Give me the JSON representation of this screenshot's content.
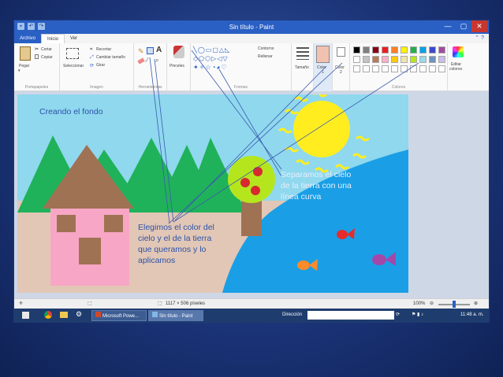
{
  "window": {
    "title": "Sin título - Paint",
    "menu": {
      "file": "Archivo",
      "home": "Inicio",
      "view": "Ver"
    }
  },
  "ribbon": {
    "clipboard": {
      "paste": "Pegar",
      "cut": "Cortar",
      "copy": "Copiar",
      "label": "Portapapeles"
    },
    "image": {
      "select": "Seleccionar",
      "crop": "Recortar",
      "resize": "Cambiar tamaño",
      "rotate": "Girar",
      "label": "Imagen"
    },
    "tools": {
      "label": "Herramientas"
    },
    "brushes": {
      "label": "Pinceles"
    },
    "shapes": {
      "outline": "Contorno",
      "fill": "Rellenar",
      "label": "Formas"
    },
    "size": {
      "label": "Tamaño"
    },
    "color1": {
      "label": "Color",
      "num": "1"
    },
    "color2": {
      "label": "Color",
      "num": "2"
    },
    "colors": {
      "label": "Colores",
      "edit1": "Editar",
      "edit2": "colores"
    },
    "palette_row1": [
      "#000000",
      "#7f7f7f",
      "#880015",
      "#ed1c24",
      "#ff7f27",
      "#fff200",
      "#22b14c",
      "#00a2e8",
      "#3f48cc",
      "#a349a4"
    ],
    "palette_row2": [
      "#ffffff",
      "#c3c3c3",
      "#b97a57",
      "#ffaec9",
      "#ffc90e",
      "#efe4b0",
      "#b5e61d",
      "#99d9ea",
      "#7092be",
      "#c8bfe7"
    ]
  },
  "status": {
    "size": "1117 × 506 píxeles",
    "zoom": "100%"
  },
  "taskbar": {
    "app1": "Microsoft Powe...",
    "app2": "Sin título - Paint",
    "address": "Dirección",
    "time": "11:48 a. m."
  },
  "annotations": {
    "background": "Creando el fondo",
    "separate": [
      "Separamos el cielo",
      "de la tierra con una",
      "línea curva"
    ],
    "choose": [
      "Elegimos el color del",
      "cielo y el de la tierra",
      "que queramos y lo",
      "aplicamos"
    ]
  }
}
